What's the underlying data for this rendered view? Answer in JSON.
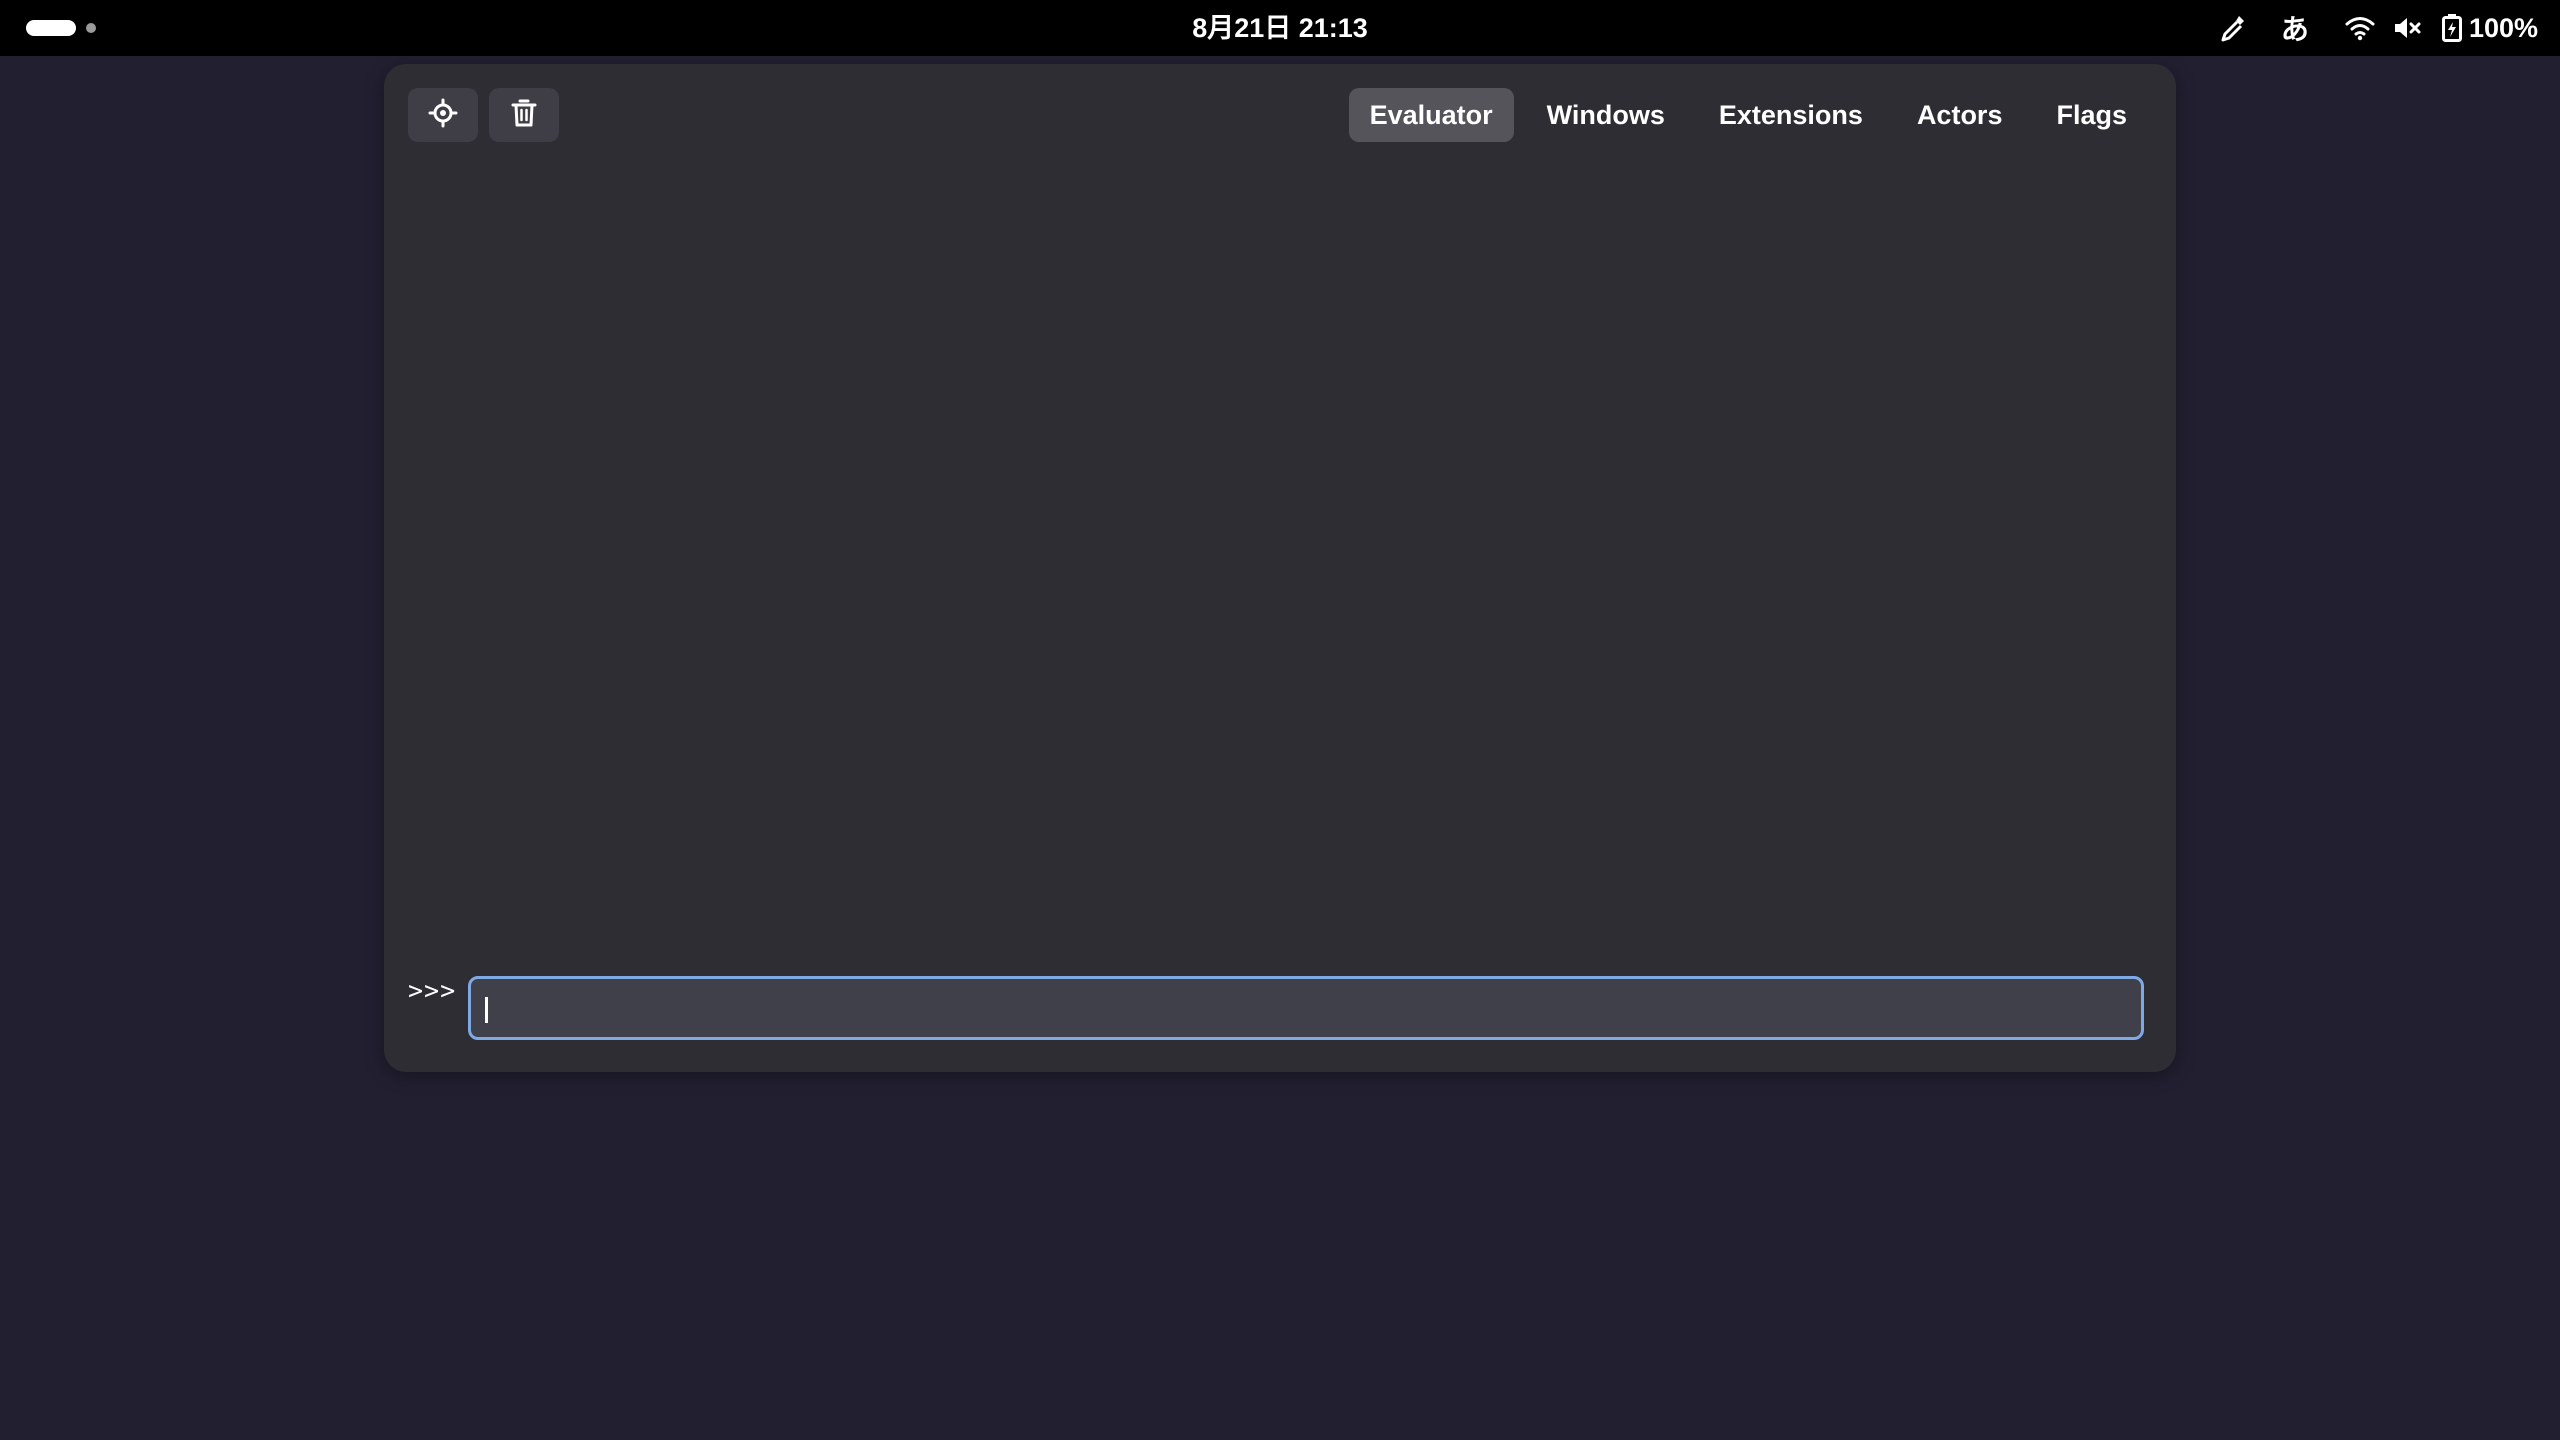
{
  "topbar": {
    "clock": "8月21日  21:13",
    "input_method": "あ",
    "battery_percent": "100%",
    "icons": [
      "color-picker-icon",
      "wifi-icon",
      "volume-muted-icon",
      "battery-charging-icon"
    ]
  },
  "looking_glass": {
    "toolbar": {
      "picker_icon": "target-crosshair-icon",
      "clear_icon": "trash-icon"
    },
    "tabs": [
      {
        "label": "Evaluator",
        "active": true
      },
      {
        "label": "Windows",
        "active": false
      },
      {
        "label": "Extensions",
        "active": false
      },
      {
        "label": "Actors",
        "active": false
      },
      {
        "label": "Flags",
        "active": false
      }
    ],
    "evaluator": {
      "prompt": ">>>",
      "input_value": ""
    }
  },
  "colors": {
    "desktop_bg": "#221f31",
    "panel_bg": "#000000",
    "window_bg": "#2e2d34",
    "button_bg": "#3f3e46",
    "active_tab_bg": "#55545b",
    "focus_border": "#7fa9e4"
  }
}
